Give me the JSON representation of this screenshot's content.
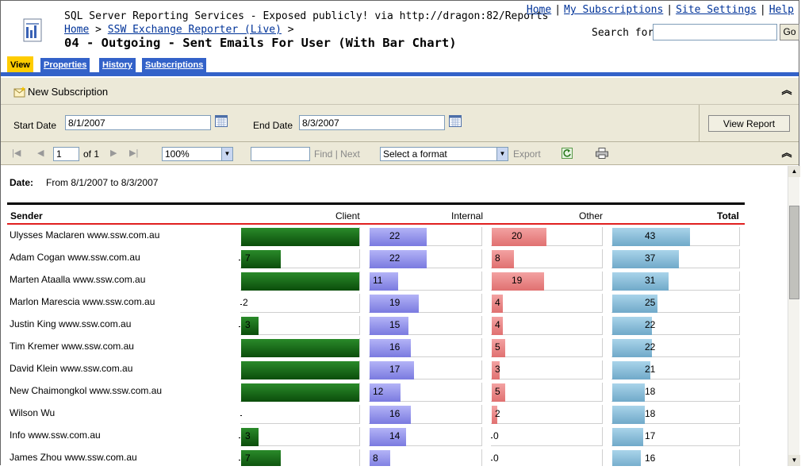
{
  "header": {
    "server_line": "SQL Server Reporting Services - Exposed publicly! via http://dragon:82/Reports",
    "breadcrumb_home": "Home",
    "breadcrumb_sep1": ">",
    "breadcrumb_folder": "SSW Exchange Reporter (Live)",
    "breadcrumb_sep2": ">",
    "title": "04 - Outgoing - Sent Emails For User (With Bar Chart)",
    "links": {
      "home": "Home",
      "subscriptions": "My Subscriptions",
      "settings": "Site Settings",
      "help": "Help",
      "sep": "|"
    },
    "search_label": "Search for:",
    "search_value": "",
    "go_label": "Go"
  },
  "tabs": [
    {
      "label": "View",
      "active": true
    },
    {
      "label": "Properties",
      "active": false
    },
    {
      "label": "History",
      "active": false
    },
    {
      "label": "Subscriptions",
      "active": false
    }
  ],
  "subscription_bar": {
    "label": "New Subscription",
    "collapse_glyph": "︽"
  },
  "parameters": {
    "start_label": "Start Date",
    "start_value": "8/1/2007",
    "end_label": "End Date",
    "end_value": "8/3/2007",
    "view_report_label": "View Report"
  },
  "nav": {
    "first_glyph": "|◀",
    "prev_glyph": "◀",
    "next_glyph": "▶",
    "last_glyph": "▶|",
    "page_value": "1",
    "of_text": "of 1",
    "zoom_value": "100%",
    "find_value": "",
    "find_label": "Find",
    "find_sep": "|",
    "next_label": "Next",
    "format_value": "Select a format",
    "export_label": "Export",
    "collapse_glyph": "︽"
  },
  "report": {
    "date_label": "Date:",
    "date_value": "From 8/1/2007 to 8/3/2007",
    "columns": {
      "sender": "Sender",
      "client": "Client",
      "internal": "Internal",
      "other": "Other",
      "total": "Total"
    },
    "rows": [
      {
        "sender": "Ulysses Maclaren www.ssw.com.au",
        "client": 21,
        "client_label": "",
        "internal": 22,
        "other": 20,
        "total": 43
      },
      {
        "sender": "Adam Cogan www.ssw.com.au",
        "client": 7,
        "client_label": "7",
        "internal": 22,
        "other": 8,
        "total": 37
      },
      {
        "sender": "Marten Ataalla www.ssw.com.au",
        "client": 21,
        "client_label": "",
        "internal": 11,
        "other": 19,
        "total": 31
      },
      {
        "sender": "Marlon Marescia www.ssw.com.au",
        "client": 0,
        "client_label": "2",
        "internal": 19,
        "other": 4,
        "total": 25
      },
      {
        "sender": "Justin King www.ssw.com.au",
        "client": 3,
        "client_label": "3",
        "internal": 15,
        "other": 4,
        "total": 22
      },
      {
        "sender": "Tim Kremer www.ssw.com.au",
        "client": 21,
        "client_label": "",
        "internal": 16,
        "other": 5,
        "total": 22
      },
      {
        "sender": "David Klein www.ssw.com.au",
        "client": 21,
        "client_label": "",
        "internal": 17,
        "other": 3,
        "total": 21
      },
      {
        "sender": "New Chaimongkol www.ssw.com.au",
        "client": 21,
        "client_label": "",
        "internal": 12,
        "other": 5,
        "total": 18
      },
      {
        "sender": "Wilson Wu",
        "client": 0,
        "client_label": "",
        "internal": 16,
        "other": 2,
        "total": 18
      },
      {
        "sender": "Info www.ssw.com.au",
        "client": 3,
        "client_label": "3",
        "internal": 14,
        "other": 0,
        "total": 17
      },
      {
        "sender": "James Zhou www.ssw.com.au",
        "client": 7,
        "client_label": "7",
        "internal": 8,
        "other": 0,
        "total": 16
      }
    ]
  },
  "colors": {
    "tab_blue": "#3362c9",
    "tab_active": "#ffcc00",
    "client_bar": "#1a6b1a",
    "internal_bar": "#9a9aee",
    "other_bar": "#eb8a8a",
    "total_bar": "#8cc0dc",
    "header_rule": "#e02020"
  }
}
